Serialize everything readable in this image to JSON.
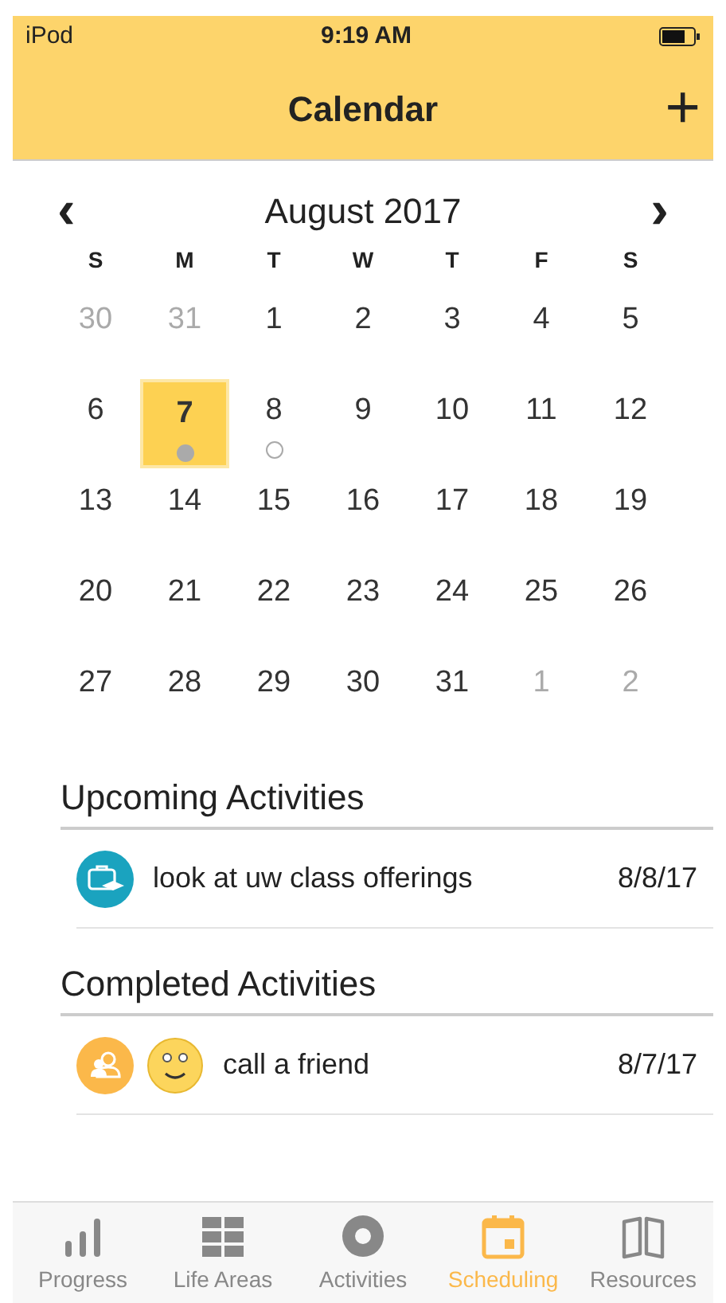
{
  "status_bar": {
    "carrier": "iPod",
    "time": "9:19 AM"
  },
  "nav": {
    "title": "Calendar",
    "add": "+"
  },
  "calendar": {
    "month": "August 2017",
    "prev": "‹",
    "next": "›",
    "weekdays": [
      "S",
      "M",
      "T",
      "W",
      "T",
      "F",
      "S"
    ],
    "weeks": [
      [
        {
          "label": "30",
          "in_month": false,
          "selected": false
        },
        {
          "label": "31",
          "in_month": false,
          "selected": false
        },
        {
          "label": "1",
          "in_month": true,
          "selected": false
        },
        {
          "label": "2",
          "in_month": true,
          "selected": false
        },
        {
          "label": "3",
          "in_month": true,
          "selected": false
        },
        {
          "label": "4",
          "in_month": true,
          "selected": false
        },
        {
          "label": "5",
          "in_month": true,
          "selected": false
        }
      ],
      [
        {
          "label": "6",
          "in_month": true,
          "selected": false
        },
        {
          "label": "7",
          "in_month": true,
          "selected": true,
          "scheduled": true,
          "completed": true
        },
        {
          "label": "8",
          "in_month": true,
          "selected": false,
          "scheduled": true,
          "completed": false
        },
        {
          "label": "9",
          "in_month": true,
          "selected": false
        },
        {
          "label": "10",
          "in_month": true,
          "selected": false
        },
        {
          "label": "11",
          "in_month": true,
          "selected": false
        },
        {
          "label": "12",
          "in_month": true,
          "selected": false
        }
      ],
      [
        {
          "label": "13",
          "in_month": true,
          "selected": false
        },
        {
          "label": "14",
          "in_month": true,
          "selected": false
        },
        {
          "label": "15",
          "in_month": true,
          "selected": false
        },
        {
          "label": "16",
          "in_month": true,
          "selected": false
        },
        {
          "label": "17",
          "in_month": true,
          "selected": false
        },
        {
          "label": "18",
          "in_month": true,
          "selected": false
        },
        {
          "label": "19",
          "in_month": true,
          "selected": false
        }
      ],
      [
        {
          "label": "20",
          "in_month": true,
          "selected": false
        },
        {
          "label": "21",
          "in_month": true,
          "selected": false
        },
        {
          "label": "22",
          "in_month": true,
          "selected": false
        },
        {
          "label": "23",
          "in_month": true,
          "selected": false
        },
        {
          "label": "24",
          "in_month": true,
          "selected": false
        },
        {
          "label": "25",
          "in_month": true,
          "selected": false
        },
        {
          "label": "26",
          "in_month": true,
          "selected": false
        }
      ],
      [
        {
          "label": "27",
          "in_month": true,
          "selected": false
        },
        {
          "label": "28",
          "in_month": true,
          "selected": false
        },
        {
          "label": "29",
          "in_month": true,
          "selected": false
        },
        {
          "label": "30",
          "in_month": true,
          "selected": false
        },
        {
          "label": "31",
          "in_month": true,
          "selected": false
        },
        {
          "label": "1",
          "in_month": false,
          "selected": false
        },
        {
          "label": "2",
          "in_month": false,
          "selected": false
        }
      ]
    ]
  },
  "sections": [
    {
      "title": "Upcoming Activities",
      "items": [
        {
          "icons": [
            {
              "kind": "education",
              "color": "#1aa3bf"
            }
          ],
          "name": "look at uw class offerings",
          "date": "8/8/17"
        }
      ]
    },
    {
      "title": "Completed Activities",
      "items": [
        {
          "icons": [
            {
              "kind": "social",
              "color": "#fbb84a"
            },
            {
              "kind": "mood"
            }
          ],
          "name": "call a friend",
          "date": "8/7/17"
        }
      ]
    }
  ],
  "tabs": [
    {
      "label": "Progress",
      "kind": "bars",
      "selected": false
    },
    {
      "label": "Life Areas",
      "kind": "grid",
      "selected": false
    },
    {
      "label": "Activities",
      "kind": "ring",
      "selected": false
    },
    {
      "label": "Scheduling",
      "kind": "calendar",
      "selected": true
    },
    {
      "label": "Resources",
      "kind": "book",
      "selected": false
    }
  ]
}
